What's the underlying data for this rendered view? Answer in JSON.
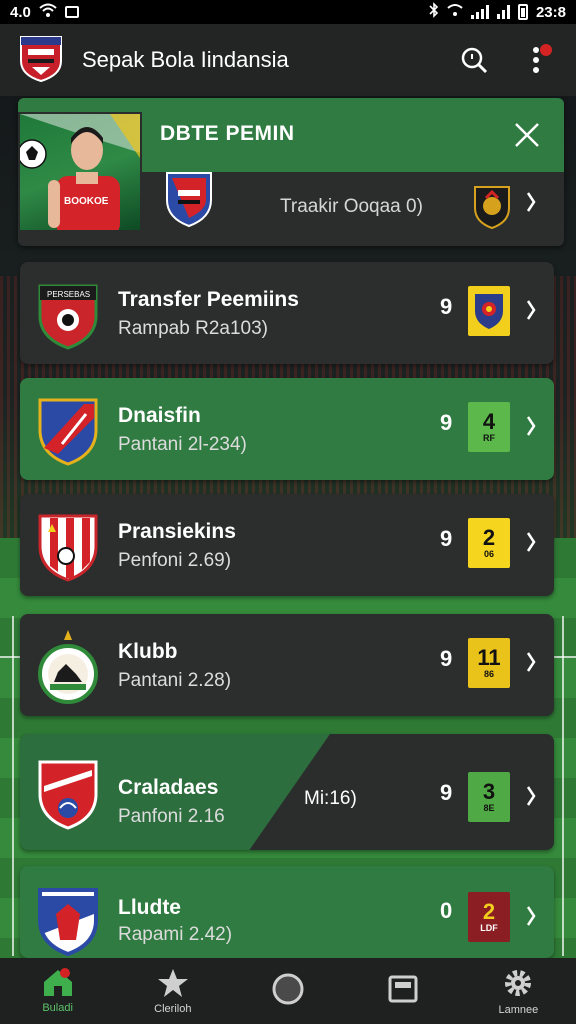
{
  "status_bar": {
    "left_text": "4.0",
    "time": "23:8"
  },
  "app_bar": {
    "title": "Sepak Bola Iindansia"
  },
  "overlay": {
    "title": "DBTE PEMIN",
    "subtitle": "Traakir Ooqaa 0)"
  },
  "cards": [
    {
      "name": "Transfer Peemiins",
      "sub": "Rampab R2a103)",
      "mid": "",
      "num": "9",
      "badge_main": "",
      "badge_small": "",
      "badge_color": "#f2cf1d",
      "style": "dark"
    },
    {
      "name": "Dnaisfin",
      "sub": "Pantani 2l-234)",
      "mid": "",
      "num": "9",
      "badge_main": "4",
      "badge_small": "RF",
      "badge_color": "#5cb84a",
      "style": "green"
    },
    {
      "name": "Pransiekins",
      "sub": "Penfoni 2.69)",
      "mid": "",
      "num": "9",
      "badge_main": "2",
      "badge_small": "06",
      "badge_color": "#f5d51e",
      "style": "dark"
    },
    {
      "name": "Klubb",
      "sub": "Pantani 2.28)",
      "mid": "",
      "num": "9",
      "badge_main": "11",
      "badge_small": "86",
      "badge_color": "#e9c21a",
      "style": "dark"
    },
    {
      "name": "Craladaes",
      "sub": "Panfoni 2.16",
      "mid": "Mi:16)",
      "num": "9",
      "badge_main": "3",
      "badge_small": "8E",
      "badge_color": "#4faa45",
      "style": "split"
    },
    {
      "name": "Lludte",
      "sub": "Rapami 2.42)",
      "mid": "",
      "num": "0",
      "badge_main": "2",
      "badge_small": "LDF",
      "badge_color": "#8a1e22",
      "style": "green"
    }
  ],
  "bottom_nav": [
    {
      "label": "Buladi",
      "icon": "home-icon"
    },
    {
      "label": "Cleriloh",
      "icon": "star-icon"
    },
    {
      "label": "",
      "icon": "ball-icon"
    },
    {
      "label": "",
      "icon": "news-icon"
    },
    {
      "label": "Lamnee",
      "icon": "gear-icon"
    }
  ],
  "colors": {
    "accent_green": "#2f7b41",
    "nav_active": "#5cc06a"
  }
}
